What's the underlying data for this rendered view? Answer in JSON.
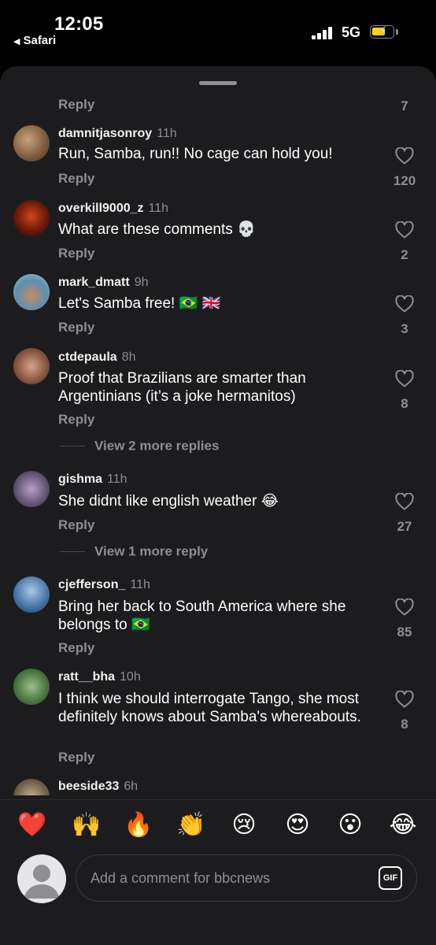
{
  "status_bar": {
    "time": "12:05",
    "back_label": "Safari",
    "network": "5G",
    "icons": [
      "signal-icon",
      "battery-charging-icon"
    ]
  },
  "colors": {
    "sheet_bg": "#1c1c1e",
    "muted_text": "#8e8e93",
    "battery": "#ffd60a"
  },
  "top_row": {
    "reply_label": "Reply",
    "likes": "7"
  },
  "comments": [
    {
      "username": "damnitjasonroy",
      "time": "11h",
      "text": "Run, Samba, run!! No cage can hold you!",
      "reply_label": "Reply",
      "likes": "120"
    },
    {
      "username": "overkill9000_z",
      "time": "11h",
      "text": "What are these comments 💀",
      "reply_label": "Reply",
      "likes": "2"
    },
    {
      "username": "mark_dmatt",
      "time": "9h",
      "text": "Let's Samba free! 🇧🇷 🇬🇧",
      "reply_label": "Reply",
      "likes": "3"
    },
    {
      "username": "ctdepaula",
      "time": "8h",
      "text": "Proof that Brazilians are smarter than Argentinians (it’s a joke hermanitos)",
      "reply_label": "Reply",
      "likes": "8",
      "view_more": "View 2 more replies"
    },
    {
      "username": "gishma",
      "time": "11h",
      "text": "She didnt like english weather 😂",
      "reply_label": "Reply",
      "likes": "27",
      "view_more": "View 1 more reply"
    },
    {
      "username": "cjefferson_",
      "time": "11h",
      "text": "Bring her back to South America where she belongs to 🇧🇷",
      "reply_label": "Reply",
      "likes": "85"
    },
    {
      "username": "ratt__bha",
      "time": "10h",
      "text": "I think we should interrogate Tango, she most definitely knows about Samba's whereabouts.",
      "reply_label": "Reply",
      "likes": "8"
    },
    {
      "username": "beeside33",
      "time": "6h"
    }
  ],
  "emoji_reactions": [
    "❤️",
    "🙌",
    "🔥",
    "👏",
    "😢",
    "😍",
    "😮",
    "😂"
  ],
  "composer": {
    "placeholder": "Add a comment for bbcnews",
    "gif_label": "GIF"
  }
}
